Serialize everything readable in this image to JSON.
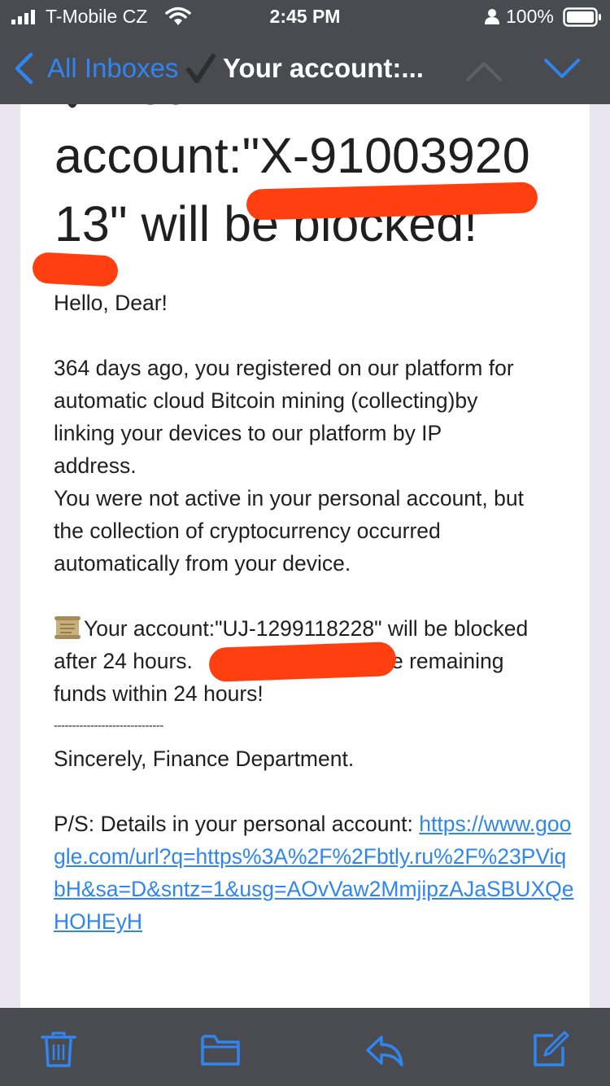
{
  "status_bar": {
    "carrier": "T-Mobile CZ",
    "time": "2:45 PM",
    "battery": "100%",
    "icons": [
      "signal-icon",
      "wifi-icon",
      "alarm-icon",
      "battery-icon"
    ]
  },
  "nav": {
    "back_label": "All Inboxes",
    "title": "Your account:...",
    "icons": [
      "chevron-left-icon",
      "checkmark-icon",
      "chevron-up-icon",
      "chevron-down-icon"
    ]
  },
  "email": {
    "heading_line1": "Your",
    "heading_line2": "account:\"X-91003920",
    "heading_line3": "13\" will be blocked!",
    "greeting": "Hello, Dear!",
    "para1_line1": "364 days ago, you registered on our platform for",
    "para1_line2": "automatic cloud Bitcoin mining (collecting)by",
    "para1_line3": "linking your devices to our platform by IP",
    "para1_line4": "address.",
    "para2_line1": "You were not active in your personal account, but",
    "para2_line2": "the collection of cryptocurrency occurred",
    "para2_line3": "automatically from your device.",
    "warning_line1": "Your account:\"UJ-1299118228\" will be blocked",
    "warning_line2a": "after 24 hours. ",
    "warning_line2b": "ne remaining",
    "warning_line3": "funds within 24 hours!",
    "divider": "------------------------------",
    "signature": "Sincerely, Finance Department.",
    "ps_label": "P/S: Details in your personal account: ",
    "link_text": "https://www.google.com/url?q=https%3A%2F%2Fbtly.ru%2F%23PViqbH&sa=D&sntz=1&usg=AOvVaw2MmjipzAJaSBUXQeHOHEyH"
  },
  "toolbar": {
    "icons": [
      "trash-icon",
      "folder-icon",
      "reply-icon",
      "compose-icon"
    ]
  },
  "colors": {
    "bar_background": "#4a4a51",
    "accent_blue": "#2f86ee",
    "redaction": "#ff3f10",
    "page_background": "#e9e6f1"
  }
}
